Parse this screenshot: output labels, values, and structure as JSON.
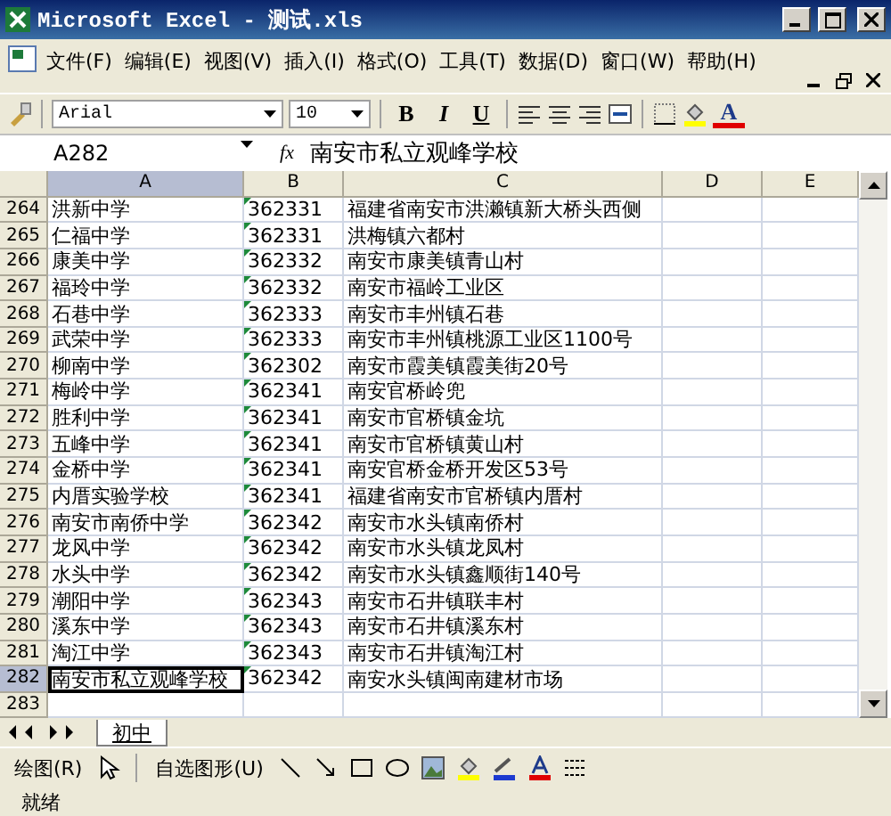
{
  "window": {
    "title": "Microsoft Excel - 测试.xls"
  },
  "menu": [
    "文件(F)",
    "编辑(E)",
    "视图(V)",
    "插入(I)",
    "格式(O)",
    "工具(T)",
    "数据(D)",
    "窗口(W)",
    "帮助(H)"
  ],
  "toolbar": {
    "font": "Arial",
    "size": "10",
    "bold": "B",
    "italic": "I",
    "underline": "U",
    "font_color": "A"
  },
  "formula_bar": {
    "name_box": "A282",
    "fx": "fx",
    "value": "南安市私立观峰学校"
  },
  "columns": [
    {
      "label": "A",
      "selected": true
    },
    {
      "label": "B",
      "selected": false
    },
    {
      "label": "C",
      "selected": false
    },
    {
      "label": "D",
      "selected": false
    },
    {
      "label": "E",
      "selected": false
    }
  ],
  "rows": [
    {
      "num": "264",
      "a": "洪新中学",
      "b": "362331",
      "c": "福建省南安市洪濑镇新大桥头西侧",
      "selected": false
    },
    {
      "num": "265",
      "a": "仁福中学",
      "b": "362331",
      "c": "洪梅镇六都村",
      "selected": false
    },
    {
      "num": "266",
      "a": "康美中学",
      "b": "362332",
      "c": "南安市康美镇青山村",
      "selected": false
    },
    {
      "num": "267",
      "a": "福玲中学",
      "b": "362332",
      "c": "南安市福岭工业区",
      "selected": false
    },
    {
      "num": "268",
      "a": "石巷中学",
      "b": "362333",
      "c": "南安市丰州镇石巷",
      "selected": false
    },
    {
      "num": "269",
      "a": "武荣中学",
      "b": "362333",
      "c": "南安市丰州镇桃源工业区1100号",
      "selected": false
    },
    {
      "num": "270",
      "a": "柳南中学",
      "b": "362302",
      "c": "南安市霞美镇霞美街20号",
      "selected": false
    },
    {
      "num": "271",
      "a": "梅岭中学",
      "b": "362341",
      "c": "南安官桥岭兜",
      "selected": false
    },
    {
      "num": "272",
      "a": "胜利中学",
      "b": "362341",
      "c": "南安市官桥镇金坑",
      "selected": false
    },
    {
      "num": "273",
      "a": "五峰中学",
      "b": "362341",
      "c": "南安市官桥镇黄山村",
      "selected": false
    },
    {
      "num": "274",
      "a": "金桥中学",
      "b": "362341",
      "c": "南安官桥金桥开发区53号",
      "selected": false
    },
    {
      "num": "275",
      "a": "内厝实验学校",
      "b": "362341",
      "c": "福建省南安市官桥镇内厝村",
      "selected": false
    },
    {
      "num": "276",
      "a": "南安市南侨中学",
      "b": "362342",
      "c": "南安市水头镇南侨村",
      "selected": false
    },
    {
      "num": "277",
      "a": "龙风中学",
      "b": "362342",
      "c": "南安市水头镇龙凤村",
      "selected": false
    },
    {
      "num": "278",
      "a": "水头中学",
      "b": "362342",
      "c": "南安市水头镇鑫顺街140号",
      "selected": false
    },
    {
      "num": "279",
      "a": "潮阳中学",
      "b": "362343",
      "c": "南安市石井镇联丰村",
      "selected": false
    },
    {
      "num": "280",
      "a": "溪东中学",
      "b": "362343",
      "c": "南安市石井镇溪东村",
      "selected": false
    },
    {
      "num": "281",
      "a": "淘江中学",
      "b": "362343",
      "c": "南安市石井镇淘江村",
      "selected": false
    },
    {
      "num": "282",
      "a": "南安市私立观峰学校",
      "b": "362342",
      "c": "南安水头镇闽南建材市场",
      "selected": true
    },
    {
      "num": "283",
      "selected": false
    }
  ],
  "sheet_tabs": [
    {
      "label": "初中",
      "selected": true
    }
  ],
  "drawing_toolbar": {
    "draw": "绘图(R)",
    "autoshapes": "自选图形(U)"
  },
  "status_bar": {
    "text": "就绪"
  }
}
